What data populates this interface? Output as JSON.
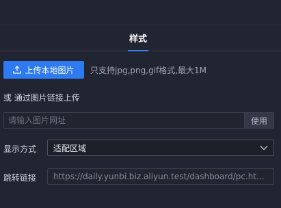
{
  "tabs": {
    "active_label": "样式"
  },
  "upload": {
    "button_label": "上传本地图片",
    "button_icon": "upload-icon",
    "hint": "只支持jpg,png,gif格式,最大1M"
  },
  "link_upload": {
    "label": "或 通过图片链接上传",
    "placeholder": "请输入图片网址",
    "use_button_label": "使用"
  },
  "display_mode": {
    "label": "显示方式",
    "selected": "适配区域",
    "dropdown_icon": "chevron-down-icon"
  },
  "jump_link": {
    "label": "跳转链接",
    "value": "https://daily.yunbi.biz.aliyun.test/dashboard/pc.ht..."
  },
  "colors": {
    "background": "#212431",
    "accent": "#2e7af0",
    "tab_underline": "#3f7ff6"
  }
}
